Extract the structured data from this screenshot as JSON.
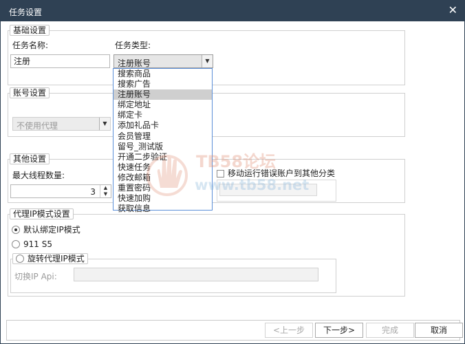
{
  "window": {
    "title": "任务设置",
    "close_glyph": "✕"
  },
  "basic": {
    "legend": "基础设置",
    "task_name_label": "任务名称:",
    "task_name_value": "注册",
    "task_type_label": "任务类型:",
    "task_type_value": "注册账号",
    "options": [
      "搜索商品",
      "搜索广告",
      "注册账号",
      "绑定地址",
      "绑定卡",
      "添加礼品卡",
      "会员管理",
      "留号_测试版",
      "开通二步验证",
      "快速任务",
      "修改邮箱",
      "重置密码",
      "快速加购",
      "获取信息"
    ],
    "selected_index": 2
  },
  "account": {
    "legend": "账号设置",
    "proxy_value": "不使用代理"
  },
  "other": {
    "legend": "其他设置",
    "max_threads_label": "最大线程数量:",
    "max_threads_value": "3",
    "move_error_label": "移动运行错误账户到其他分类",
    "move_error_checked": false
  },
  "proxy_mode": {
    "legend": "代理IP模式设置",
    "default_bind_label": "默认绑定IP模式",
    "default_bind_selected": true,
    "s5_label": "911 S5",
    "s5_selected": false,
    "rotate_label": "旋转代理IP模式",
    "rotate_selected": false,
    "switch_api_label": "切换IP Api:",
    "switch_api_value": ""
  },
  "buttons": {
    "prev": "<上一步",
    "next": "下一步>",
    "finish": "完成",
    "cancel": "取消"
  },
  "watermark": {
    "line1": "TB58论坛",
    "line2": "www.tb58.net"
  },
  "colors": {
    "titlebar": "#2f4154",
    "dropdown_border": "#5b8fd8",
    "selected_option": "#cfcfcf"
  }
}
